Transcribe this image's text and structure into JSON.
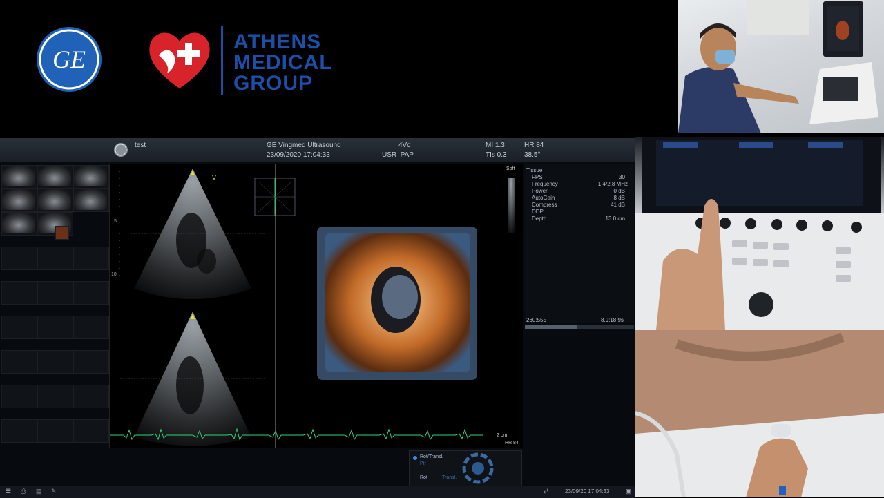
{
  "header": {
    "ge_logo_text": "GE",
    "brand_lines": [
      "ATHENS",
      "MEDICAL",
      "GROUP"
    ]
  },
  "ultrasound": {
    "patient_name": "test",
    "system_name": "GE Vingmed Ultrasound",
    "datetime": "23/09/2020 17:04:33",
    "probe": "4Vc",
    "preset": "USR  PAP",
    "mi": "MI 1.3",
    "tis": "TIs 0.3",
    "hr": "HR 84",
    "temp": "38.5°",
    "soft_label": "Soft",
    "scale_marks": [
      "5",
      "10"
    ],
    "v_marker": "V",
    "params_title": "Tissue",
    "params": [
      {
        "label": "FPS",
        "value": "30"
      },
      {
        "label": "Frequency",
        "value": "1.4/2.8 MHz"
      },
      {
        "label": "Power",
        "value": "0 dB"
      },
      {
        "label": "AutoGain",
        "value": "8 dB"
      },
      {
        "label": "Compress",
        "value": "41 dB"
      },
      {
        "label": "DDP",
        "value": ""
      },
      {
        "label": "Depth",
        "value": "13.0 cm"
      }
    ],
    "frame_counter_left": "260:555",
    "frame_counter_right": "8.9:18.9s",
    "scale_bar": "2 cm",
    "ecg_hr": "HR 84",
    "rot_labels": {
      "rot_transl": "Rot/Transl.",
      "ptr": "Ptr",
      "rot": "Rot",
      "transl": "Transl."
    },
    "bottom_datetime": "23/09/20 17:04:33"
  },
  "colors": {
    "brand_blue": "#1c4fa8",
    "heart_red": "#d8232a",
    "ecg_green": "#34d07a",
    "marker_yellow": "#e8e020"
  }
}
